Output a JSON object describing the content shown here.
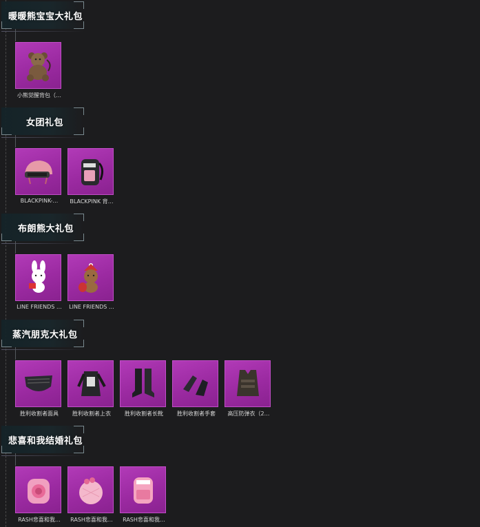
{
  "sections": [
    {
      "title": "暖暖熊宝宝大礼包",
      "items": [
        {
          "label": "小熊觉醒背包（…",
          "icon": "teddy-bear-backpack-icon"
        }
      ]
    },
    {
      "title": "女团礼包",
      "items": [
        {
          "label": "BLACKPINK-…",
          "icon": "pink-helmet-icon"
        },
        {
          "label": "BLACKPINK 背…",
          "icon": "black-backpack-icon"
        }
      ]
    },
    {
      "title": "布朗熊大礼包",
      "items": [
        {
          "label": "LINE FRIENDS …",
          "icon": "cony-bunny-icon"
        },
        {
          "label": "LINE FRIENDS …",
          "icon": "brown-bear-icon"
        }
      ]
    },
    {
      "title": "蒸汽朋克大礼包",
      "items": [
        {
          "label": "胜利收割者面具",
          "icon": "mask-icon"
        },
        {
          "label": "胜利收割者上衣",
          "icon": "jacket-icon"
        },
        {
          "label": "胜利收割者长靴",
          "icon": "boots-icon"
        },
        {
          "label": "胜利收割者手套",
          "icon": "gloves-icon"
        },
        {
          "label": "高压防弹衣（2…",
          "icon": "vest-icon"
        }
      ]
    },
    {
      "title": "悲喜和我结婚礼包",
      "items": [
        {
          "label": "RASH悲喜和我…",
          "icon": "rose-backpack-icon"
        },
        {
          "label": "RASH悲喜和我…",
          "icon": "round-pink-bag-icon"
        },
        {
          "label": "RASH悲喜和我…",
          "icon": "pink-backpack-icon"
        }
      ]
    }
  ]
}
